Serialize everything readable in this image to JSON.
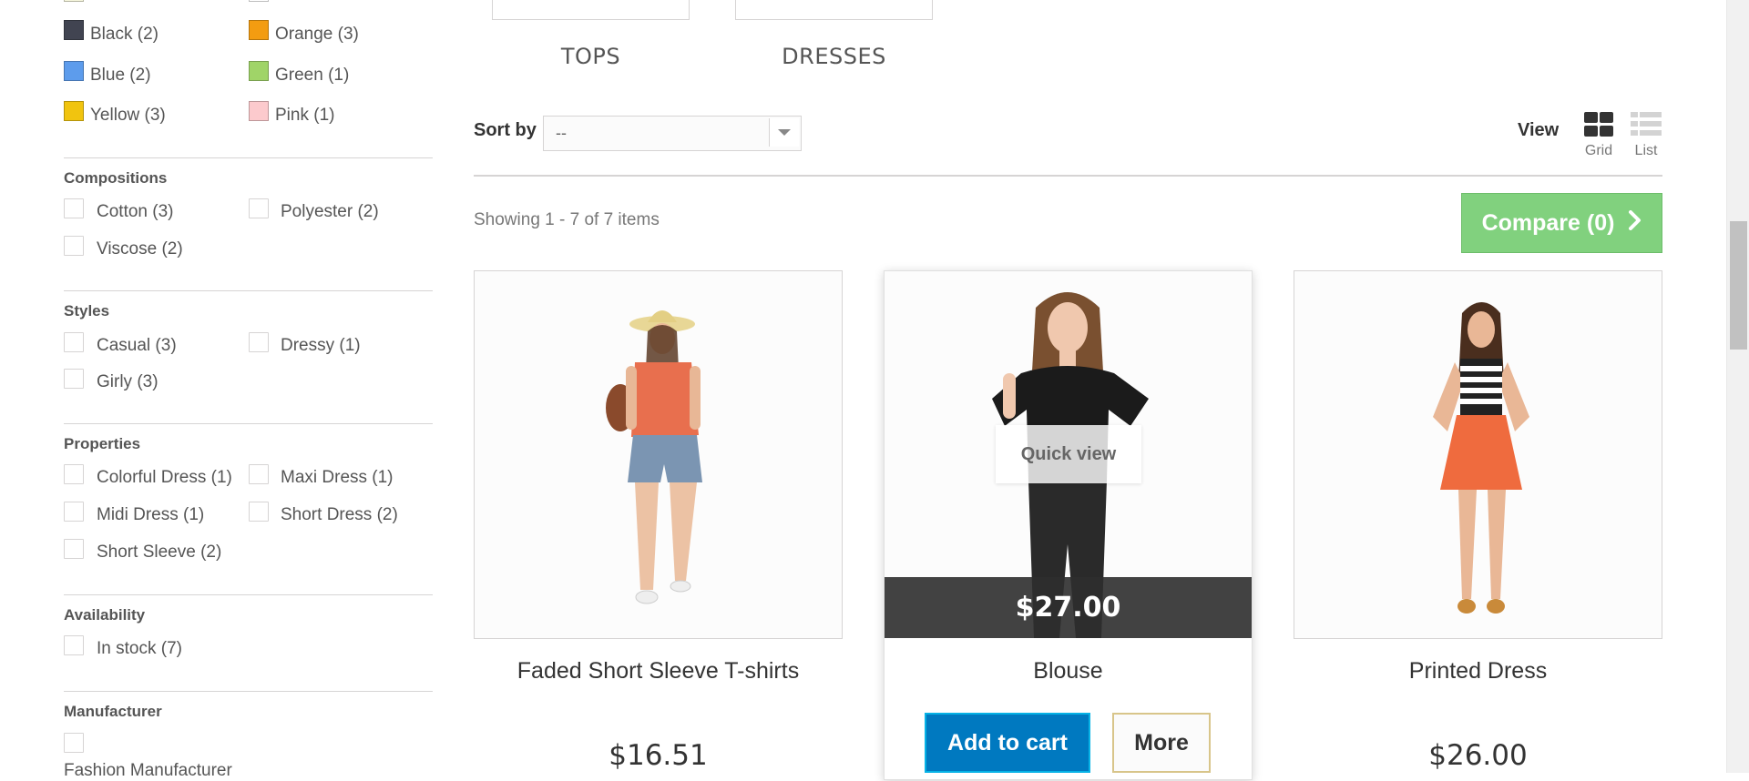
{
  "colors": {
    "black": "#414451",
    "orange": "#F39C11",
    "blue": "#5D9CEC",
    "green": "#A0D468",
    "yellow": "#F1C40F",
    "pink": "#FCCACD",
    "accent_blue": "#0079c0",
    "compare_green": "#81d17e"
  },
  "sidebar": {
    "color_filters": [
      {
        "label": "Black (2)",
        "color": "#414451"
      },
      {
        "label": "Orange (3)",
        "color": "#F39C11"
      },
      {
        "label": "Blue (2)",
        "color": "#5D9CEC"
      },
      {
        "label": "Green (1)",
        "color": "#A0D468"
      },
      {
        "label": "Yellow (3)",
        "color": "#F1C40F"
      },
      {
        "label": "Pink (1)",
        "color": "#FCCACD"
      }
    ],
    "compositions": {
      "title": "Compositions",
      "items": [
        "Cotton (3)",
        "Polyester (2)",
        "Viscose (2)"
      ]
    },
    "styles": {
      "title": "Styles",
      "items": [
        "Casual (3)",
        "Dressy (1)",
        "Girly (3)"
      ]
    },
    "properties": {
      "title": "Properties",
      "items": [
        "Colorful Dress (1)",
        "Maxi Dress (1)",
        "Midi Dress (1)",
        "Short Dress (2)",
        "Short Sleeve (2)"
      ]
    },
    "availability": {
      "title": "Availability",
      "items": [
        "In stock (7)"
      ]
    },
    "manufacturer": {
      "title": "Manufacturer",
      "items": [
        "Fashion Manufacturer"
      ]
    }
  },
  "subcategories": [
    "TOPS",
    "DRESSES"
  ],
  "toolbar": {
    "sort_label": "Sort by",
    "sort_value": "--",
    "view_label": "View",
    "grid_label": "Grid",
    "list_label": "List"
  },
  "listing": {
    "showing_text": "Showing 1 - 7 of 7 items",
    "compare_label": "Compare (0)"
  },
  "products": [
    {
      "name": "Faded Short Sleeve T-shirts",
      "price": "$16.51"
    },
    {
      "name": "Blouse",
      "price": "$27.00",
      "quick_view": "Quick view",
      "add_to_cart": "Add to cart",
      "more": "More"
    },
    {
      "name": "Printed Dress",
      "price": "$26.00"
    }
  ]
}
